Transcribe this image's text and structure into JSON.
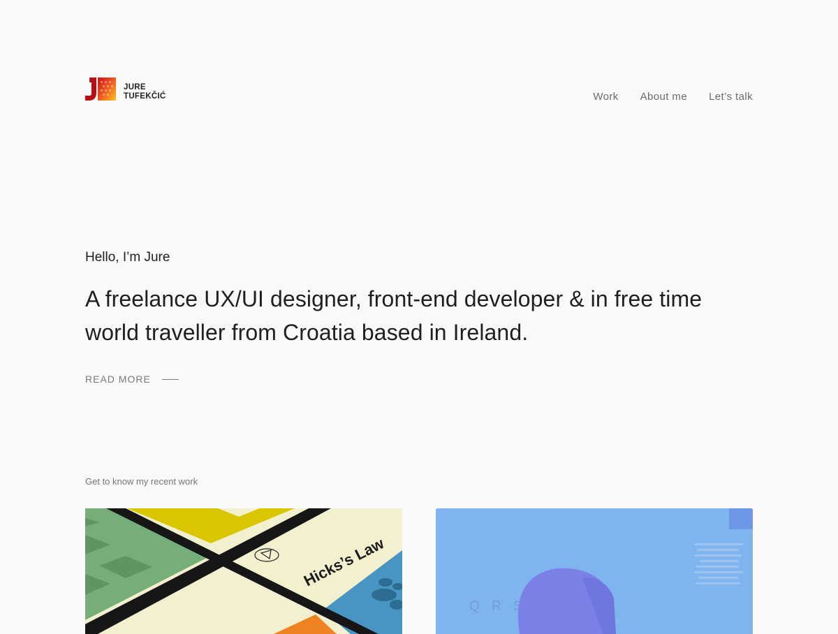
{
  "brand": {
    "first_name": "JURE",
    "last_name": "TUFEKČIĆ",
    "colors": {
      "red": "#d6191f",
      "orange": "#f28a1c",
      "yellow": "#f7c21d"
    }
  },
  "nav": {
    "items": [
      {
        "label": "Work"
      },
      {
        "label": "About me"
      },
      {
        "label": "Let’s talk"
      }
    ]
  },
  "hero": {
    "greeting": "Hello, I’m Jure",
    "intro": "A freelance UX/UI designer, front-end developer & in free time world traveller from Croatia based in Ireland.",
    "read_more": "READ MORE"
  },
  "work": {
    "label": "Get to know my recent work",
    "cards": [
      {
        "image_text": "Hicks’s Law",
        "image_icon": "triangle-in-circle-icon"
      },
      {
        "image_text": "Q R S Y Z 1",
        "image_icon": "person-silhouette"
      }
    ]
  },
  "colors": {
    "background": "#faf9f7",
    "text": "#1f1f1f",
    "muted": "#757575"
  }
}
